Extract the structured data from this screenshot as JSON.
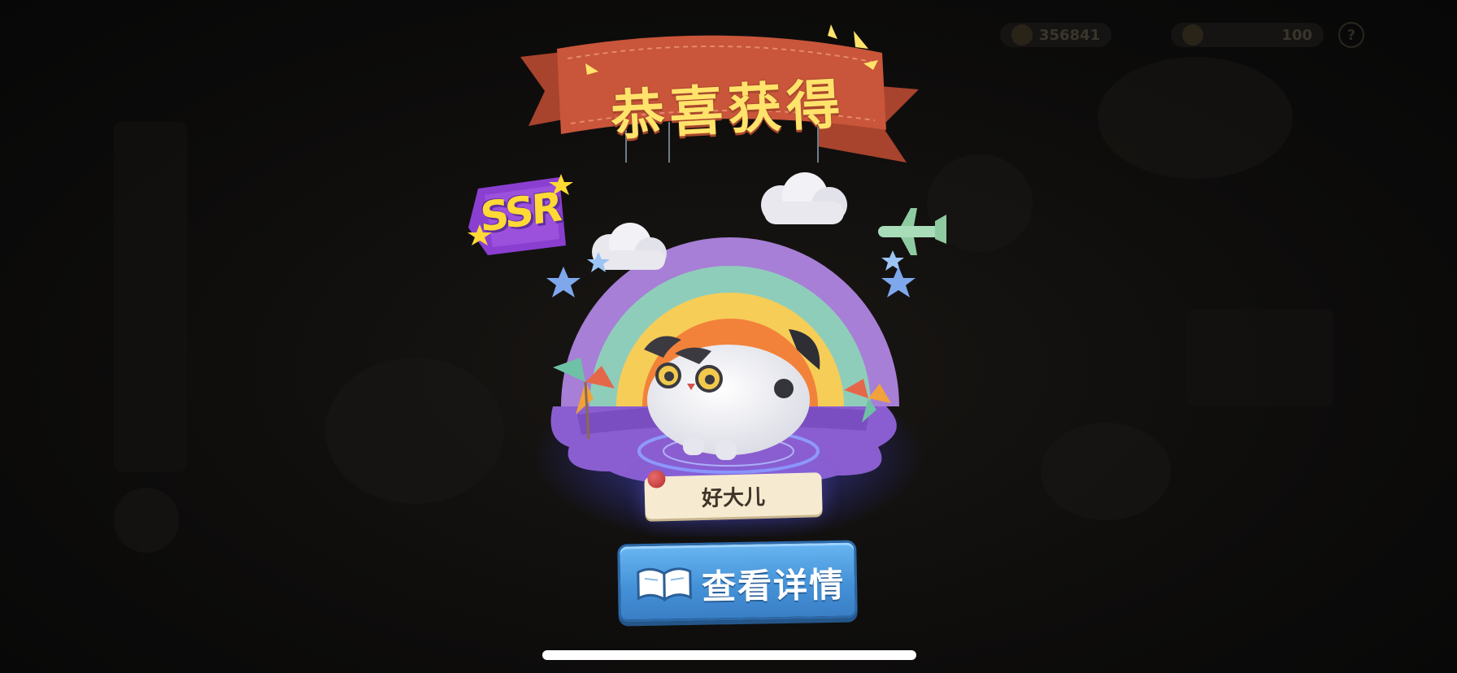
{
  "hud": {
    "coins": "356841",
    "gems": "100",
    "help_glyph": "?",
    "coin_icon": "coin-icon",
    "gem_icon": "gem-icon"
  },
  "banner": {
    "title": "恭喜获得"
  },
  "reward": {
    "rarity": "SSR",
    "pet_name": "好大儿",
    "rarity_color": "#8b3fd1",
    "rarity_text_color": "#ffd936"
  },
  "actions": {
    "details_label": "查看详情",
    "details_icon": "book-icon"
  },
  "colors": {
    "banner": "#c9553a",
    "title": "#ffe36b",
    "button": "#4592d8",
    "rainbow": [
      "#a77fd6",
      "#8fcdbb",
      "#f6cd57",
      "#f2823a"
    ]
  }
}
